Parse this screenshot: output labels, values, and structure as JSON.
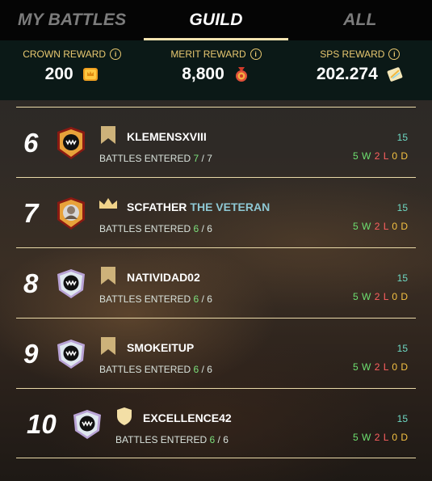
{
  "tabs": [
    {
      "label": "MY BATTLES",
      "active": false
    },
    {
      "label": "GUILD",
      "active": true
    },
    {
      "label": "ALL",
      "active": false
    }
  ],
  "rewards": {
    "crown": {
      "label": "CROWN REWARD",
      "value": "200",
      "icon": "crown-coin-icon"
    },
    "merit": {
      "label": "MERIT REWARD",
      "value": "8,800",
      "icon": "merit-medal-icon"
    },
    "sps": {
      "label": "SPS REWARD",
      "value": "202.274",
      "icon": "sps-token-icon"
    }
  },
  "info_glyph": "i",
  "battles_label": "BATTLES ENTERED",
  "colors": {
    "accent": "#f4e3b0",
    "gold": "#e8c870",
    "win": "#6de070",
    "loss": "#ff6060",
    "draw": "#f5c242",
    "score": "#6ed9c4"
  },
  "rows": [
    {
      "rank": "6",
      "name": "KLEMENSXVIII",
      "title": "",
      "entered": "7",
      "total": "7",
      "score": "15",
      "w": "5 W",
      "l": "2 L",
      "d": "0 D",
      "badge": "banner-icon",
      "avatar": "red-skull-avatar"
    },
    {
      "rank": "7",
      "name": "SCFATHER",
      "title": "THE VETERAN",
      "entered": "6",
      "total": "6",
      "score": "15",
      "w": "5 W",
      "l": "2 L",
      "d": "0 D",
      "badge": "crown-icon",
      "avatar": "red-player-avatar"
    },
    {
      "rank": "8",
      "name": "NATIVIDAD02",
      "title": "",
      "entered": "6",
      "total": "6",
      "score": "15",
      "w": "5 W",
      "l": "2 L",
      "d": "0 D",
      "badge": "banner-icon",
      "avatar": "silver-skull-avatar"
    },
    {
      "rank": "9",
      "name": "SMOKEITUP",
      "title": "",
      "entered": "6",
      "total": "6",
      "score": "15",
      "w": "5 W",
      "l": "2 L",
      "d": "0 D",
      "badge": "banner-icon",
      "avatar": "silver-skull-avatar"
    },
    {
      "rank": "10",
      "name": "EXCELLENCE42",
      "title": "",
      "entered": "6",
      "total": "6",
      "score": "15",
      "w": "5 W",
      "l": "2 L",
      "d": "0 D",
      "badge": "shield-icon",
      "avatar": "silver-skull-avatar"
    }
  ]
}
